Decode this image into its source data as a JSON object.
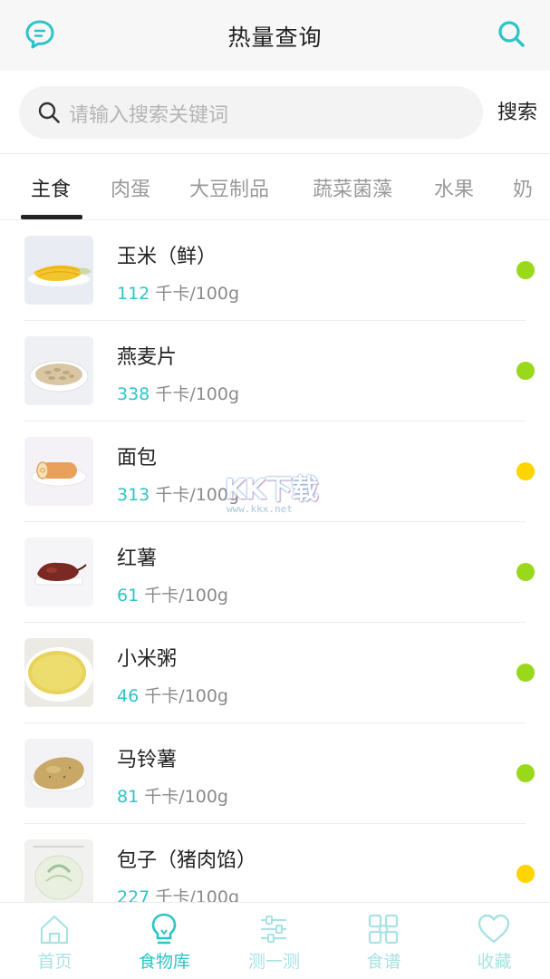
{
  "header": {
    "title": "热量查询",
    "left_icon": "chat-bubble-icon",
    "right_icon": "search-icon"
  },
  "search": {
    "placeholder": "请输入搜索关键词",
    "button_label": "搜索"
  },
  "tabs": [
    {
      "label": "主食",
      "active": true
    },
    {
      "label": "肉蛋",
      "active": false
    },
    {
      "label": "大豆制品",
      "active": false
    },
    {
      "label": "蔬菜菌藻",
      "active": false
    },
    {
      "label": "水果",
      "active": false
    },
    {
      "label": "奶",
      "active": false
    }
  ],
  "foods": [
    {
      "name": "玉米（鲜）",
      "kcal": "112",
      "unit": "千卡/100g",
      "level": "green"
    },
    {
      "name": "燕麦片",
      "kcal": "338",
      "unit": "千卡/100g",
      "level": "green"
    },
    {
      "name": "面包",
      "kcal": "313",
      "unit": "千卡/100g",
      "level": "yellow"
    },
    {
      "name": "红薯",
      "kcal": "61",
      "unit": "千卡/100g",
      "level": "green"
    },
    {
      "name": "小米粥",
      "kcal": "46",
      "unit": "千卡/100g",
      "level": "green"
    },
    {
      "name": "马铃薯",
      "kcal": "81",
      "unit": "千卡/100g",
      "level": "green"
    },
    {
      "name": "包子（猪肉馅）",
      "kcal": "227",
      "unit": "千卡/100g",
      "level": "yellow"
    }
  ],
  "watermark": {
    "big": "KK下载",
    "small": "www.kkx.net"
  },
  "bottom_nav": [
    {
      "label": "首页",
      "icon": "home-icon",
      "active": false
    },
    {
      "label": "食物库",
      "icon": "lightbulb-icon",
      "active": true
    },
    {
      "label": "测一测",
      "icon": "sliders-icon",
      "active": false
    },
    {
      "label": "食谱",
      "icon": "grid-icon",
      "active": false
    },
    {
      "label": "收藏",
      "icon": "heart-icon",
      "active": false
    }
  ],
  "colors": {
    "accent": "#2ec4c6",
    "accent_light": "#a9e2e3",
    "dot_green": "#99d81a",
    "dot_yellow": "#ffd400"
  }
}
